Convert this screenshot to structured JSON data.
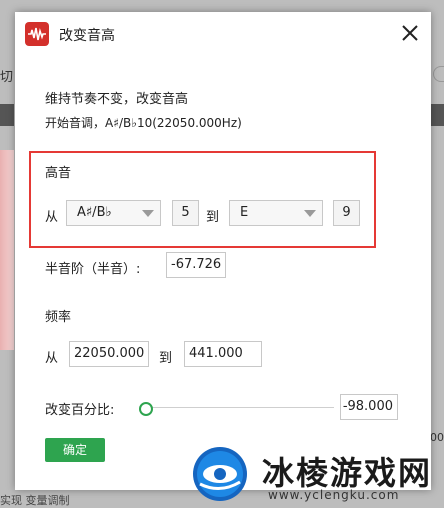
{
  "background": {
    "left_text": "切",
    "right_number": "00",
    "bottom_text": "实现  变量调制"
  },
  "dialog": {
    "title": "改变音高",
    "info_line1": "维持节奏不变，改变音高",
    "info_line2": "开始音调，A♯/B♭10(22050.000Hz)",
    "pitch": {
      "heading": "高音",
      "from_label": "从",
      "from_note": "A♯/B♭",
      "from_octave": "5",
      "to_label": "到",
      "to_note": "E",
      "to_octave": "9"
    },
    "semitone": {
      "label": "半音阶（半音）:",
      "value": "-67.726"
    },
    "frequency": {
      "heading": "频率",
      "from_label": "从",
      "from_value": "22050.000",
      "to_label": "到",
      "to_value": "441.000"
    },
    "percent": {
      "label": "改变百分比:",
      "value": "-98.000",
      "slider_fraction": 0.0
    },
    "ok_label": "确定"
  },
  "watermark": {
    "title": "冰棱游戏网",
    "url": "www.yclengku.com"
  },
  "colors": {
    "accent": "#2ea44f",
    "highlight": "#e53935",
    "app_icon": "#d3302b"
  }
}
